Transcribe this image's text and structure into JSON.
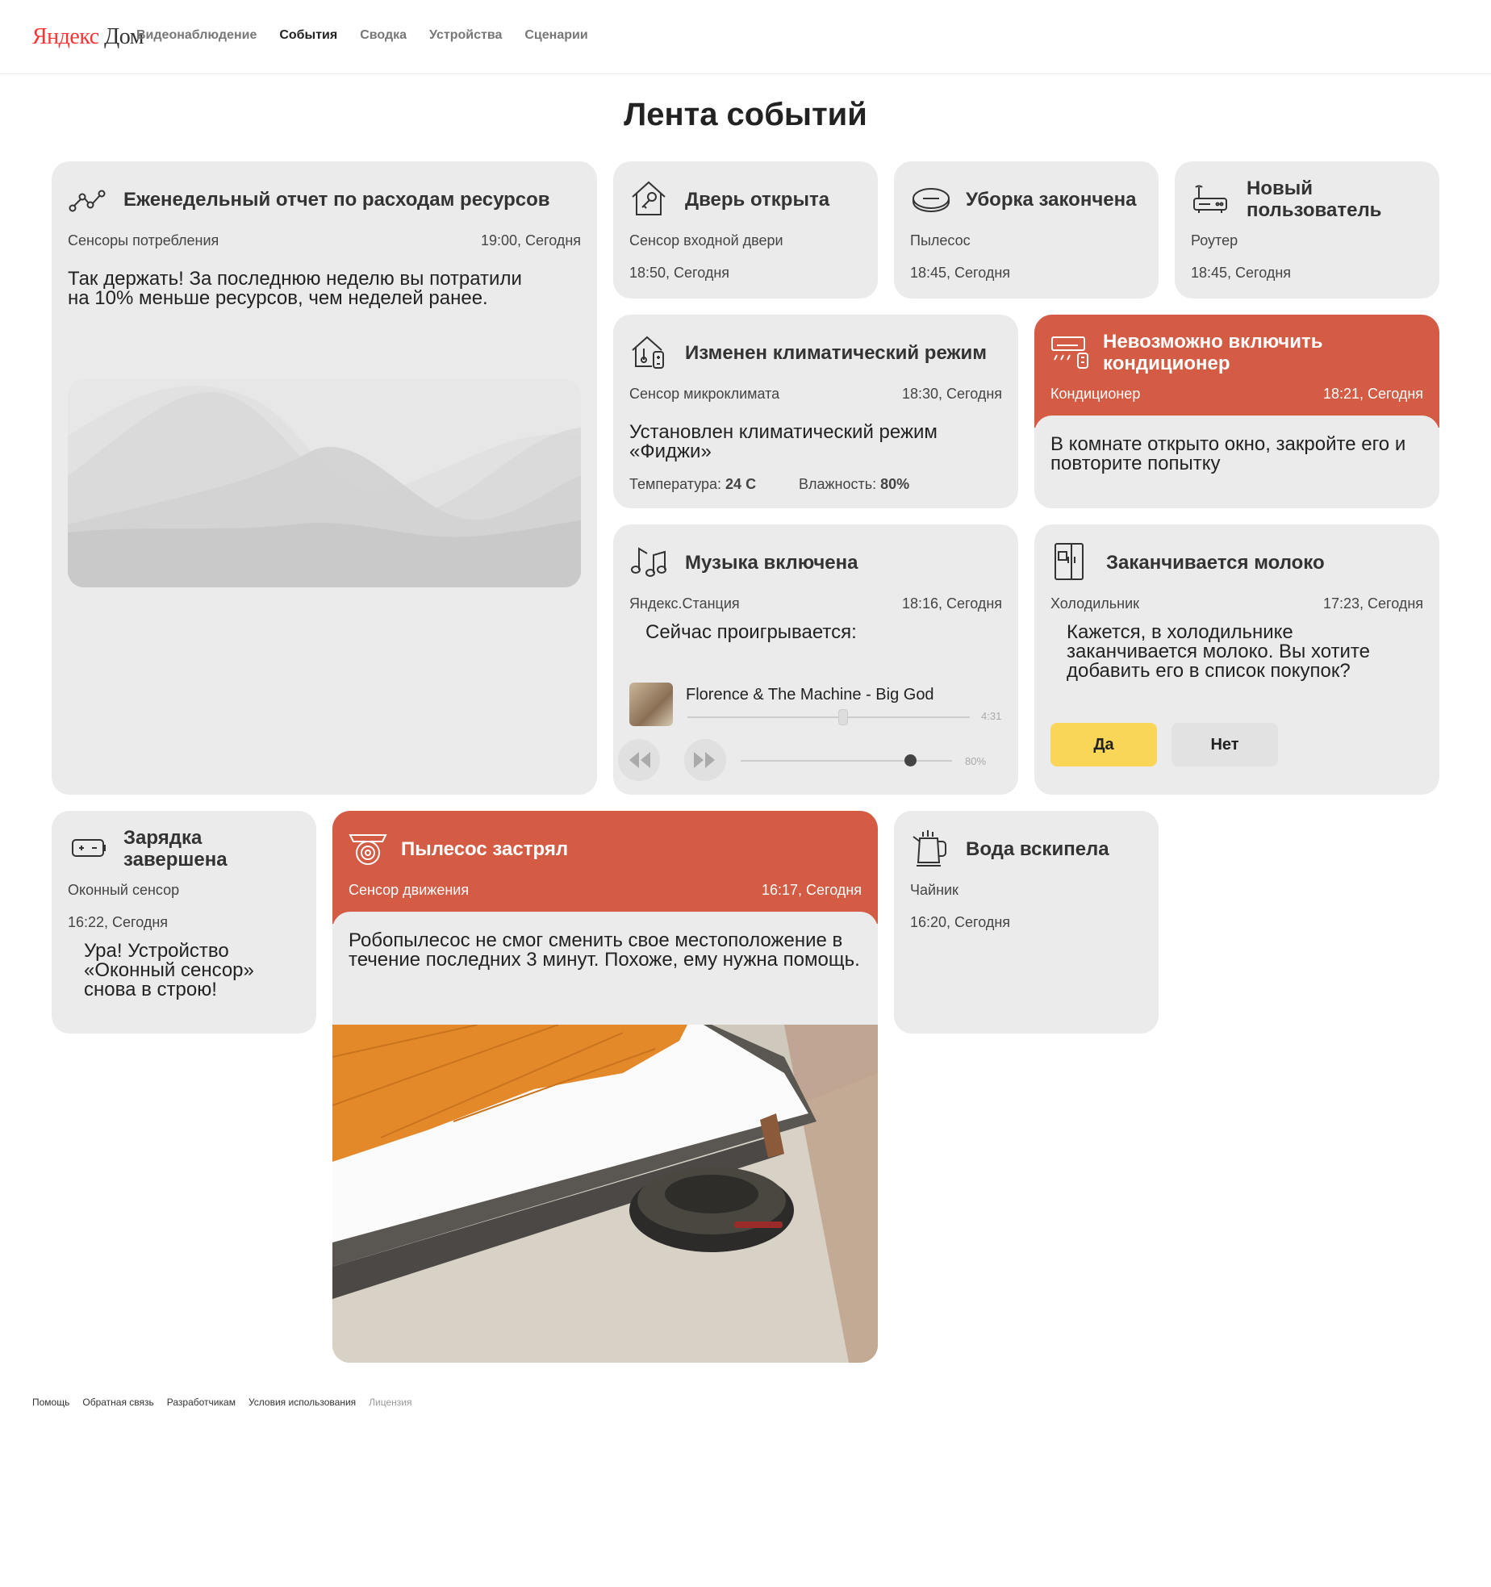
{
  "header": {
    "logo_yandex": "Яндекс",
    "logo_dom": " Дом",
    "nav": [
      {
        "label": "Видеонаблюдение",
        "active": false
      },
      {
        "label": "События",
        "active": true
      },
      {
        "label": "Сводка",
        "active": false
      },
      {
        "label": "Устройства",
        "active": false
      },
      {
        "label": "Сценарии",
        "active": false
      }
    ]
  },
  "page_title": "Лента событий",
  "cards": {
    "report": {
      "title": "Еженедельный отчет по расходам ресурсов",
      "source": "Сенсоры потребления",
      "time": "19:00, Сегодня",
      "description": "Так держать! За последнюю неделю вы потратили на 10% меньше ресурсов, чем неделей ранее."
    },
    "door": {
      "title": "Дверь открыта",
      "source": "Сенсор входной двери",
      "time": "18:50, Сегодня"
    },
    "cleaning": {
      "title": "Уборка закончена",
      "source": "Пылесос",
      "time": "18:45, Сегодня"
    },
    "user": {
      "title": "Новый пользователь",
      "source": "Роутер",
      "time": "18:45, Сегодня"
    },
    "climate": {
      "title": "Изменен климатический режим",
      "source": "Сенсор микроклимата",
      "time": "18:30, Сегодня",
      "description": "Установлен климатический режим «Фиджи»",
      "temp_label": "Температура:",
      "temp_value": "24 С",
      "humidity_label": "Влажность:",
      "humidity_value": "80%"
    },
    "aircon": {
      "title": "Невозможно включить кондиционер",
      "source": "Кондиционер",
      "time": "18:21, Сегодня",
      "description": "В комнате открыто окно, закройте его и повторите попытку"
    },
    "music": {
      "title": "Музыка включена",
      "source": "Яндекс.Станция",
      "time": "18:16, Сегодня",
      "description": "Сейчас проигрывается:",
      "track": "Florence & The Machine - Big God",
      "duration": "4:31",
      "progress": 0.55,
      "volume_label": "80%",
      "volume": 0.8
    },
    "fridge": {
      "title": "Заканчивается молоко",
      "source": "Холодильник",
      "time": "17:23, Сегодня",
      "description": "Кажется, в холодильнике заканчивается молоко. Вы хотите добавить его в список покупок?",
      "yes": "Да",
      "no": "Нет"
    },
    "charge": {
      "title": "Зарядка завершена",
      "source": "Оконный сенсор",
      "time": "16:22, Сегодня",
      "description": "Ура! Устройство «Оконный сенсор» снова в строю!"
    },
    "vacuum": {
      "title": "Пылесос застрял",
      "source": "Сенсор движения",
      "time": "16:17, Сегодня",
      "description": "Робопылесос не смог сменить свое местоположение в течение последних 3 минут. Похоже, ему нужна помощь."
    },
    "kettle": {
      "title": "Вода вскипела",
      "source": "Чайник",
      "time": "16:20, Сегодня"
    }
  },
  "footer": {
    "links": [
      "Помощь",
      "Обратная связь",
      "Разработчикам",
      "Условия использования"
    ],
    "license": "Лицензия"
  },
  "colors": {
    "critical": "#d45b44",
    "card": "#ebebeb",
    "accent_yes": "#f9d657"
  },
  "icons": [
    "graph-icon",
    "door-key-icon",
    "robot-vacuum-icon",
    "router-icon",
    "climate-house-icon",
    "air-conditioner-icon",
    "music-notes-icon",
    "fridge-icon",
    "battery-icon",
    "camera-icon",
    "kettle-icon"
  ]
}
